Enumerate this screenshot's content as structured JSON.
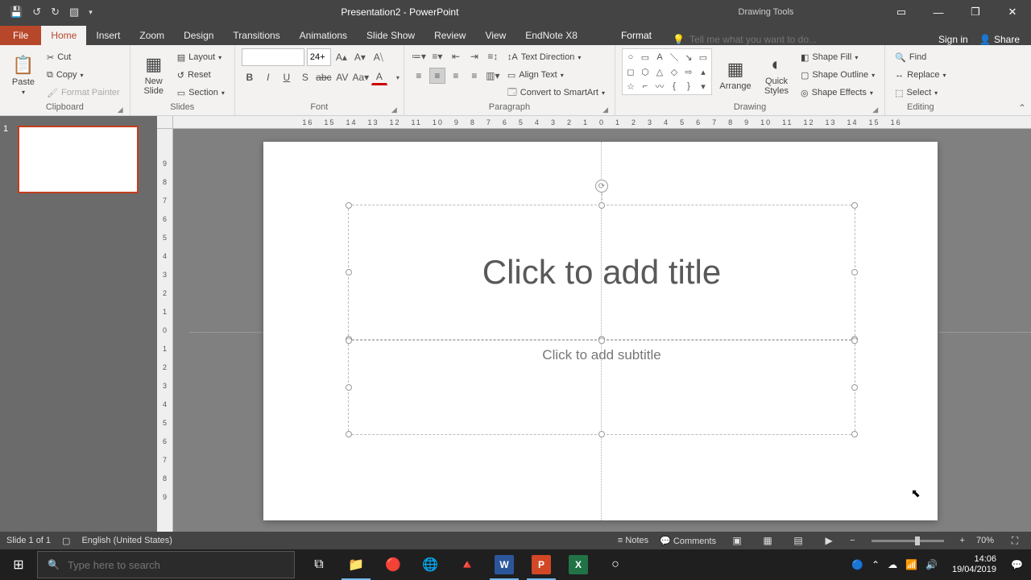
{
  "titlebar": {
    "title": "Presentation2 - PowerPoint",
    "contextual": "Drawing Tools"
  },
  "tabs": {
    "file": "File",
    "home": "Home",
    "insert": "Insert",
    "zoom": "Zoom",
    "design": "Design",
    "transitions": "Transitions",
    "animations": "Animations",
    "slideshow": "Slide Show",
    "review": "Review",
    "view": "View",
    "endnote": "EndNote X8",
    "format": "Format",
    "tellme": "Tell me what you want to do...",
    "signin": "Sign in",
    "share": "Share"
  },
  "ribbon": {
    "clipboard": {
      "label": "Clipboard",
      "paste": "Paste",
      "cut": "Cut",
      "copy": "Copy",
      "fmtpainter": "Format Painter"
    },
    "slides": {
      "label": "Slides",
      "newslide": "New\nSlide",
      "layout": "Layout",
      "reset": "Reset",
      "section": "Section"
    },
    "font": {
      "label": "Font",
      "size": "24+"
    },
    "paragraph": {
      "label": "Paragraph",
      "textdir": "Text Direction",
      "align": "Align Text",
      "smartart": "Convert to SmartArt"
    },
    "drawing": {
      "label": "Drawing",
      "arrange": "Arrange",
      "quick": "Quick\nStyles",
      "fill": "Shape Fill",
      "outline": "Shape Outline",
      "effects": "Shape Effects"
    },
    "editing": {
      "label": "Editing",
      "find": "Find",
      "replace": "Replace",
      "select": "Select"
    }
  },
  "ruler_h": [
    "16",
    "15",
    "14",
    "13",
    "12",
    "11",
    "10",
    "9",
    "8",
    "7",
    "6",
    "5",
    "4",
    "3",
    "2",
    "1",
    "0",
    "1",
    "2",
    "3",
    "4",
    "5",
    "6",
    "7",
    "8",
    "9",
    "10",
    "11",
    "12",
    "13",
    "14",
    "15",
    "16"
  ],
  "ruler_v": [
    "9",
    "8",
    "7",
    "6",
    "5",
    "4",
    "3",
    "2",
    "1",
    "0",
    "1",
    "2",
    "3",
    "4",
    "5",
    "6",
    "7",
    "8",
    "9"
  ],
  "slide": {
    "num": "1",
    "title_ph": "Click to add title",
    "subtitle_ph": "Click to add subtitle"
  },
  "status": {
    "slide": "Slide 1 of 1",
    "lang": "English (United States)",
    "notes": "Notes",
    "comments": "Comments",
    "zoom": "70%"
  },
  "taskbar": {
    "search_ph": "Type here to search",
    "time": "14:06",
    "date": "19/04/2019"
  }
}
